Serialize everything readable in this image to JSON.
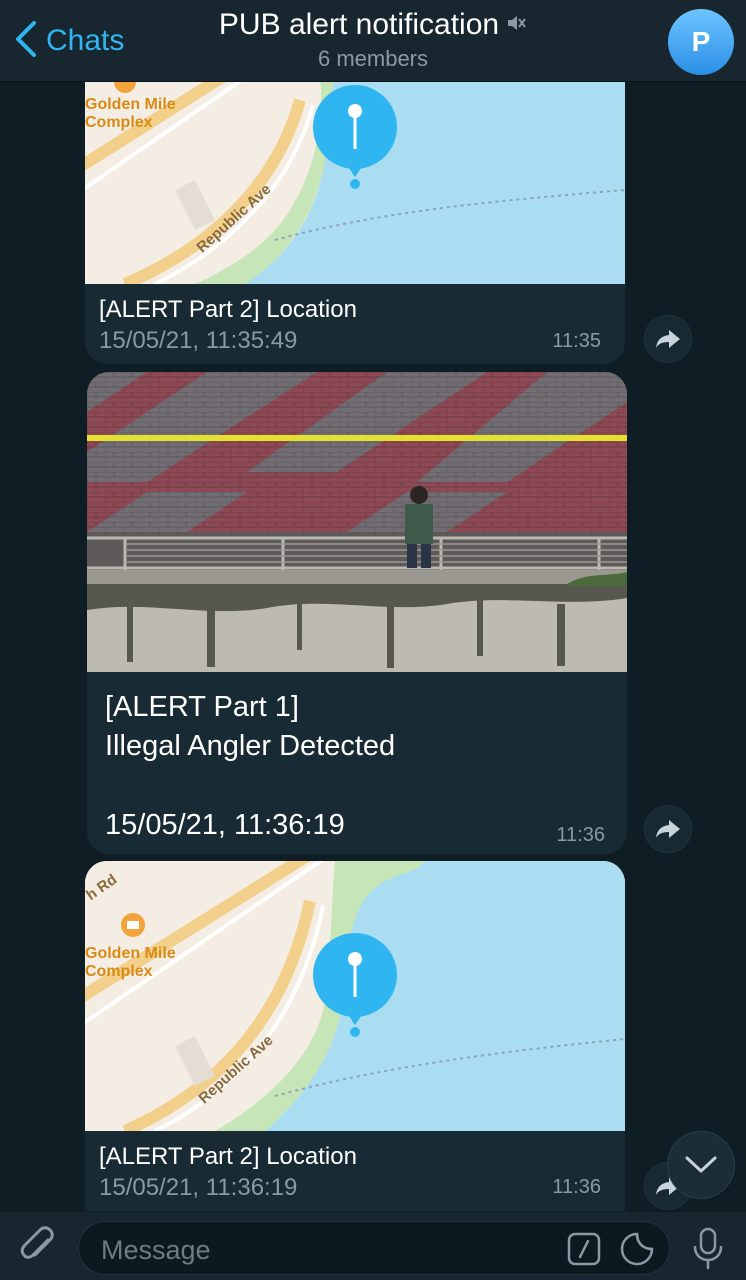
{
  "header": {
    "back_label": "Chats",
    "title": "PUB alert notification",
    "subtitle": "6 members",
    "avatar_letter": "P"
  },
  "messages": [
    {
      "type": "location",
      "map_labels": {
        "complex": "Golden Mile\nComplex",
        "road": "Republic Ave"
      },
      "caption": "[ALERT Part 2] Location",
      "date": "15/05/21, 11:35:49",
      "time": "11:35"
    },
    {
      "type": "photo",
      "line1": "[ALERT Part 1]",
      "line2": "Illegal Angler Detected",
      "date": "15/05/21, 11:36:19",
      "time": "11:36"
    },
    {
      "type": "location",
      "map_labels": {
        "complex": "Golden Mile\nComplex",
        "road": "Republic Ave",
        "road2": "h Rd"
      },
      "caption": "[ALERT Part 2] Location",
      "date": "15/05/21, 11:36:19",
      "time": "11:36"
    }
  ],
  "input": {
    "placeholder": "Message"
  },
  "colors": {
    "accent": "#2fb6f0",
    "bubble": "#182a33",
    "background": "#0f1e25",
    "water": "#aadcf2",
    "park": "#c6e6b7"
  },
  "icons": [
    "chevron-left-icon",
    "mute-icon",
    "share-icon",
    "map-pin-icon",
    "chevron-down-icon",
    "paperclip-icon",
    "bot-command-icon",
    "sticker-icon",
    "microphone-icon"
  ]
}
